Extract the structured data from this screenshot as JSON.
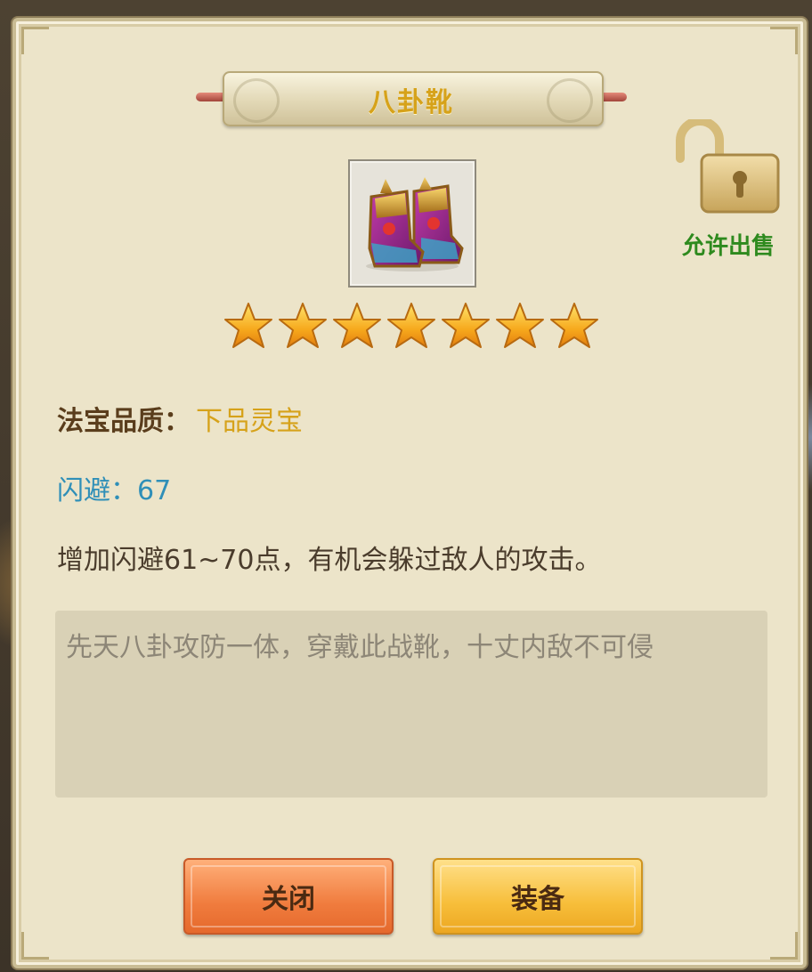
{
  "item": {
    "name": "八卦靴",
    "stars": 7,
    "icon": "boots-icon"
  },
  "lock": {
    "label": "允许出售",
    "icon": "unlocked-padlock-icon"
  },
  "stats": {
    "quality_label": "法宝品质：",
    "quality_value": "下品灵宝",
    "dodge": "闪避：67",
    "effect": "增加闪避61~70点，有机会躲过敌人的攻击。"
  },
  "lore": "先天八卦攻防一体，穿戴此战靴，十丈内敌不可侵",
  "buttons": {
    "close_label": "关闭",
    "equip_label": "装备"
  },
  "colors": {
    "title": "#d6a21a",
    "quality_value": "#d6a21a",
    "dodge": "#2f8fb8",
    "lock_label": "#2e8a1e",
    "close_button": "#f07c3e",
    "equip_button": "#f7be3a"
  }
}
